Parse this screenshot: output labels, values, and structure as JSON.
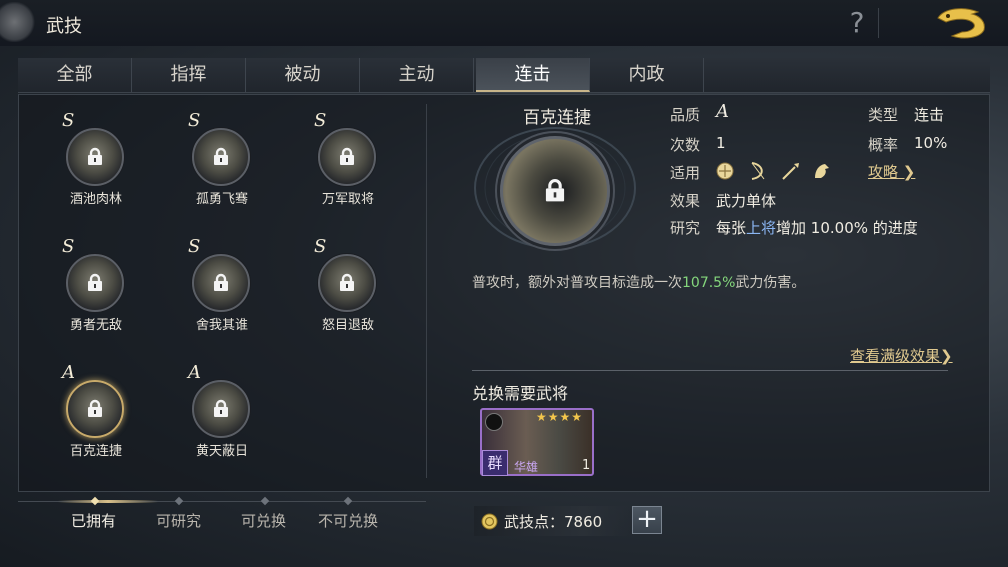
{
  "header": {
    "title": "武技",
    "help_label": "?"
  },
  "tabs": [
    {
      "label": "全部"
    },
    {
      "label": "指挥"
    },
    {
      "label": "被动"
    },
    {
      "label": "主动"
    },
    {
      "label": "连击"
    },
    {
      "label": "内政"
    }
  ],
  "active_tab": "连击",
  "skills": [
    {
      "rank": "S",
      "name": "酒池肉林"
    },
    {
      "rank": "S",
      "name": "孤勇飞骞"
    },
    {
      "rank": "S",
      "name": "万军取将"
    },
    {
      "rank": "S",
      "name": "勇者无敌"
    },
    {
      "rank": "S",
      "name": "舍我其谁"
    },
    {
      "rank": "S",
      "name": "怒目退敌"
    },
    {
      "rank": "A",
      "name": "百克连捷"
    },
    {
      "rank": "A",
      "name": "黄天蔽日"
    }
  ],
  "selected_skill": "百克连捷",
  "detail": {
    "title": "百克连捷",
    "quality_label": "品质",
    "quality_value": "A",
    "type_label": "类型",
    "type_value": "连击",
    "count_label": "次数",
    "count_value": "1",
    "chance_label": "概率",
    "chance_value": "10%",
    "apply_label": "适用",
    "apply_icons": [
      "shield-icon",
      "bow-icon",
      "spear-icon",
      "horse-icon"
    ],
    "strategy_link": "攻略",
    "effect_label": "效果",
    "effect_value": "武力单体",
    "research_label": "研究",
    "research_pre": "每张",
    "research_hl": "上将",
    "research_post": "增加 10.00% 的进度",
    "desc_pre": "普攻时，额外对普攻目标造成一次",
    "desc_hl": "107.5%",
    "desc_post": "武力伤害。",
    "full_effect_link": "查看满级效果",
    "requirement_title": "兑换需要武将"
  },
  "hero": {
    "name": "华雄",
    "faction": "群",
    "stars": "★★★★",
    "count": "1"
  },
  "filters": [
    {
      "label": "已拥有"
    },
    {
      "label": "可研究"
    },
    {
      "label": "可兑换"
    },
    {
      "label": "不可兑换"
    }
  ],
  "active_filter": "已拥有",
  "points": {
    "label": "武技点：7860"
  },
  "colors": {
    "accent_gold": "#c8aa6a",
    "highlight_green": "#84d67c",
    "highlight_blue": "#8bb6f3",
    "hero_purple": "#9a6fc9"
  }
}
